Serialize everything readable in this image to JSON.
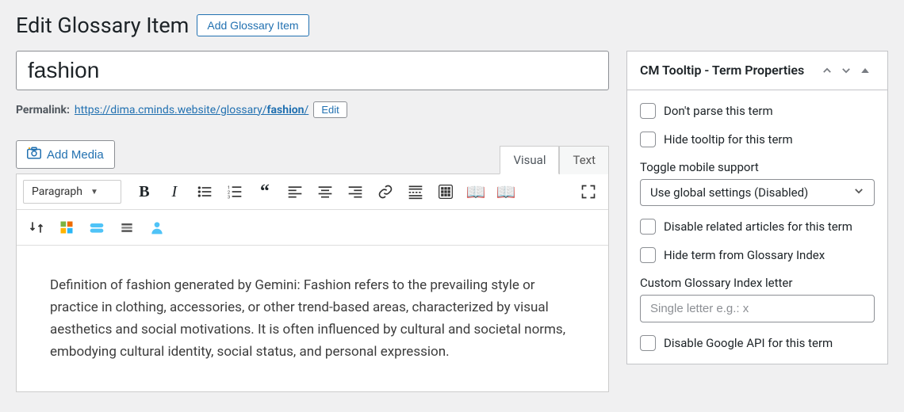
{
  "header": {
    "title": "Edit Glossary Item",
    "add_button": "Add Glossary Item"
  },
  "post": {
    "title_value": "fashion",
    "permalink_label": "Permalink:",
    "permalink_base": "https://dima.cminds.website/glossary/",
    "permalink_slug": "fashion",
    "permalink_suffix": "/",
    "edit_button": "Edit"
  },
  "media": {
    "add_media": "Add Media"
  },
  "editor": {
    "tabs": {
      "visual": "Visual",
      "text": "Text"
    },
    "format_label": "Paragraph",
    "content": "Definition of fashion generated by Gemini: Fashion refers to the prevailing style or practice in clothing, accessories, or other trend-based areas, characterized by visual aesthetics and social motivations. It is often influenced by cultural and societal norms, embodying cultural identity, social status, and personal expression."
  },
  "sidebar": {
    "box_title": "CM Tooltip - Term Properties",
    "dont_parse": "Don't parse this term",
    "hide_tooltip": "Hide tooltip for this term",
    "toggle_mobile_label": "Toggle mobile support",
    "toggle_mobile_value": "Use global settings (Disabled)",
    "disable_related": "Disable related articles for this term",
    "hide_from_index": "Hide term from Glossary Index",
    "custom_letter_label": "Custom Glossary Index letter",
    "custom_letter_placeholder": "Single letter e.g.: x",
    "disable_google": "Disable Google API for this term"
  }
}
